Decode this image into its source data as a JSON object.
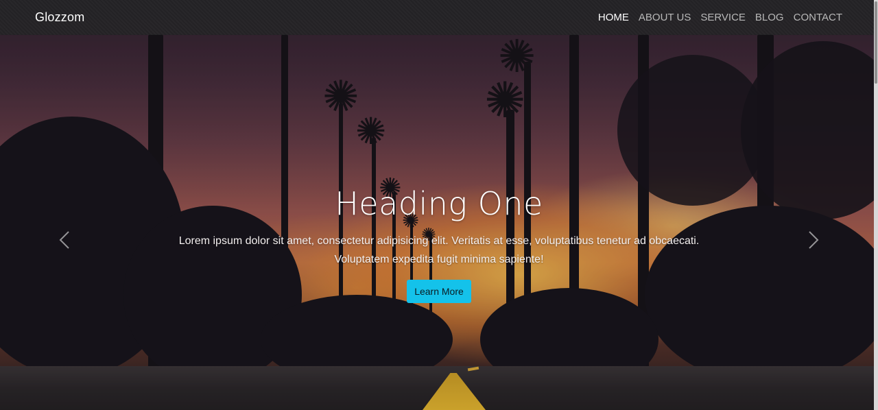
{
  "navbar": {
    "brand": "Glozzom",
    "links": [
      {
        "label": "HOME",
        "active": true
      },
      {
        "label": "ABOUT US",
        "active": false
      },
      {
        "label": "SERVICE",
        "active": false
      },
      {
        "label": "BLOG",
        "active": false
      },
      {
        "label": "CONTACT",
        "active": false
      }
    ]
  },
  "carousel": {
    "heading": "Heading One",
    "text_line1": "Lorem ipsum dolor sit amet, consectetur adipisicing elit. Veritatis at esse, voluptatibus tenetur ad obcaecati.",
    "text_line2": "Voluptatem expedita fugit minima sapiente!",
    "button_label": "Learn More",
    "prev_icon": "chevron-left-icon",
    "next_icon": "chevron-right-icon"
  },
  "colors": {
    "accent": "#14c2ea",
    "navbar_bg": "#222224",
    "nav_active": "#ffffff",
    "nav_inactive": "#b9b9b9"
  }
}
